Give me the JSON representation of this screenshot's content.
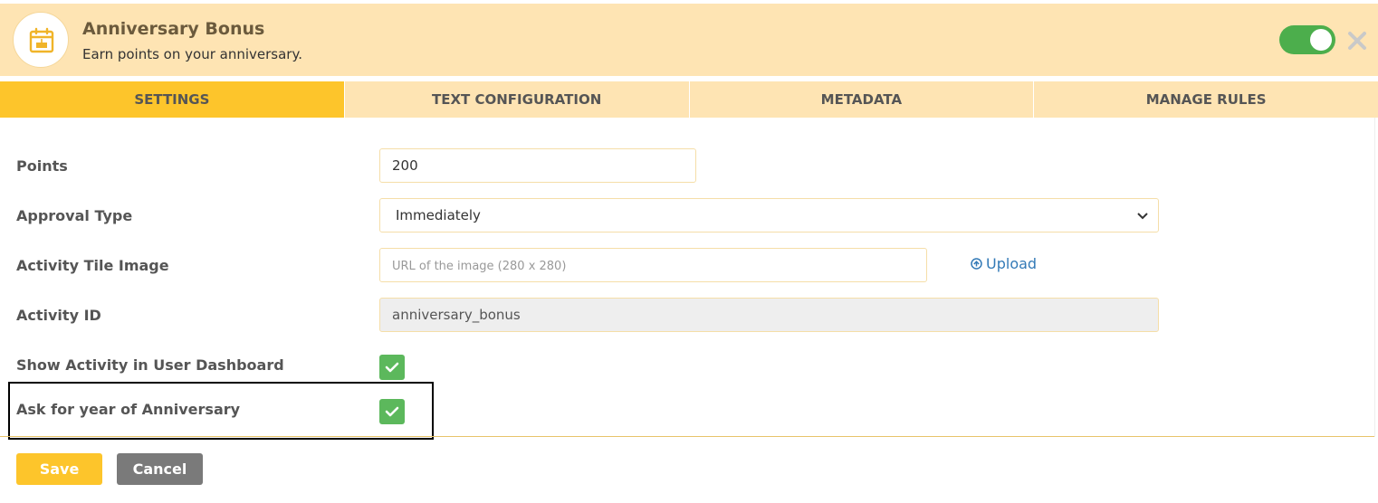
{
  "header": {
    "title": "Anniversary Bonus",
    "subtitle": "Earn points on your anniversary.",
    "icon": "calendar-icon",
    "enabled": true
  },
  "tabs": [
    {
      "label": "SETTINGS",
      "active": true
    },
    {
      "label": "TEXT CONFIGURATION",
      "active": false
    },
    {
      "label": "METADATA",
      "active": false
    },
    {
      "label": "MANAGE RULES",
      "active": false
    }
  ],
  "form": {
    "points": {
      "label": "Points",
      "value": "200"
    },
    "approval_type": {
      "label": "Approval Type",
      "value": "Immediately"
    },
    "tile_image": {
      "label": "Activity Tile Image",
      "placeholder": "URL of the image (280 x 280)",
      "upload_label": "Upload"
    },
    "activity_id": {
      "label": "Activity ID",
      "value": "anniversary_bonus"
    },
    "show_in_dashboard": {
      "label": "Show Activity in User Dashboard",
      "checked": true
    },
    "ask_year": {
      "label": "Ask for year of Anniversary",
      "checked": true
    }
  },
  "buttons": {
    "save": "Save",
    "cancel": "Cancel"
  },
  "colors": {
    "header_bg": "#fee4b3",
    "accent": "#fdc52b",
    "toggle_on": "#4cae4c",
    "checkbox": "#5cb85c",
    "link": "#337ab7",
    "cancel_bg": "#7a7a7a"
  }
}
